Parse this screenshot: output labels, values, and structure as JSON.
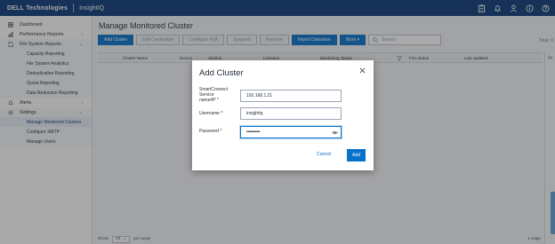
{
  "app": {
    "brand": "DELL Technologies",
    "product": "InsightIQ",
    "colors": {
      "header": "#0a3a78",
      "accent": "#0672cb",
      "scroll_accent": "#5a9fd8"
    },
    "header_icons": [
      "clipboard-icon",
      "bell-icon",
      "user-icon",
      "info-icon",
      "help-icon"
    ]
  },
  "sidebar": {
    "items": [
      {
        "label": "Dashboard",
        "icon": "dashboard-icon"
      },
      {
        "label": "Performance Reports",
        "icon": "bar-chart-icon"
      },
      {
        "label": "File System Reports",
        "icon": "file-icon"
      },
      {
        "label": "Alerts",
        "icon": "bell-icon"
      },
      {
        "label": "Settings",
        "icon": "gear-icon"
      }
    ],
    "file_system_subitems": [
      "Capacity Reporting",
      "File System Analytics",
      "Deduplication Reporting",
      "Quota Reporting",
      "Data Reduction Reporting"
    ],
    "settings_subitems": [
      "Manage Monitored Clusters",
      "Configure SMTP",
      "Manage Users"
    ]
  },
  "main": {
    "title": "Manage Monitored Cluster",
    "toolbar": {
      "add_cluster": "Add Cluster",
      "edit_credentials": "Edit Credentials",
      "configure_fsa": "Configure FSA",
      "suspend": "Suspend",
      "resume": "Resume",
      "import_datastore": "Import Datastore",
      "more": "More ▾",
      "search_placeholder": "Search"
    },
    "total_label": "Total: 0",
    "table_columns": [
      "Cluster Name",
      "Device",
      "Version",
      "Licenses",
      "Monitoring Status",
      "FSA status",
      "Last updated"
    ],
    "footer": {
      "show": "Show",
      "per_page_value": "10",
      "per_page": "per page",
      "pages": "1 page"
    }
  },
  "modal": {
    "title": "Add Cluster",
    "fields": {
      "address_label": "SmartConnect\nService\nname/IP *",
      "address_value": "192.168.1.21",
      "username_label": "Username *",
      "username_value": "insightiq",
      "password_label": "Password *",
      "password_value": "••••••••••••"
    },
    "cancel": "Cancel",
    "add": "Add"
  }
}
